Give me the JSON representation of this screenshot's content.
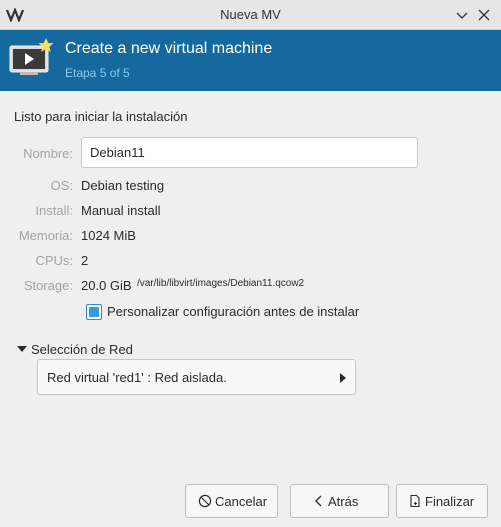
{
  "window": {
    "title": "Nueva MV"
  },
  "header": {
    "title": "Create a new virtual machine",
    "step": "Etapa 5 of 5"
  },
  "summary": {
    "heading": "Listo para iniciar la instalación",
    "name_label": "Nombre:",
    "name_value": "Debian11",
    "os_label": "OS:",
    "os_value": "Debian testing",
    "install_label": "Install:",
    "install_value": "Manual install",
    "memory_label": "Memoria:",
    "memory_value": "1024 MiB",
    "cpus_label": "CPUs:",
    "cpus_value": "2",
    "storage_label": "Storage:",
    "storage_size": "20.0 GiB",
    "storage_path": "/var/lib/libvirt/images/Debian11.qcow2"
  },
  "customize": {
    "label": "Personalizar configuración antes de instalar",
    "checked": true
  },
  "network": {
    "expander_label": "Selección de Red",
    "selected": "Red virtual 'red1' : Red aislada."
  },
  "buttons": {
    "cancel": "Cancelar",
    "back": "Atrás",
    "finish": "Finalizar"
  },
  "colors": {
    "banner": "#16699f",
    "step_text": "#89c7ef",
    "checkbox": "#3b98de"
  }
}
